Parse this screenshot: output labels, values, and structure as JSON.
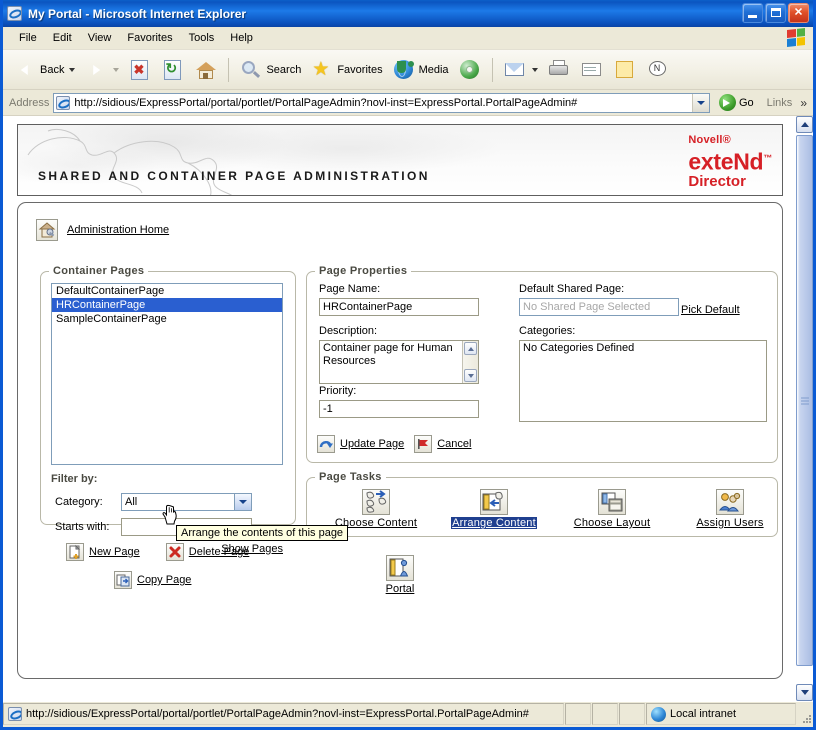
{
  "window": {
    "title": "My Portal - Microsoft Internet Explorer",
    "icon": "ie-document-icon",
    "minimize_label": "Minimize",
    "maximize_label": "Maximize",
    "close_label": "Close"
  },
  "menu": {
    "items": [
      {
        "label": "File"
      },
      {
        "label": "Edit"
      },
      {
        "label": "View"
      },
      {
        "label": "Favorites"
      },
      {
        "label": "Tools"
      },
      {
        "label": "Help"
      }
    ]
  },
  "toolbar": {
    "back_label": "Back",
    "forward_label": "",
    "stop_label": "",
    "refresh_label": "",
    "home_label": "",
    "search_label": "Search",
    "favorites_label": "Favorites",
    "media_label": "Media",
    "history_label": "",
    "mail_label": "",
    "print_label": "",
    "edit_label": "",
    "discuss_label": "",
    "messenger_label": ""
  },
  "address": {
    "label": "Address",
    "url": "http://sidious/ExpressPortal/portal/portlet/PortalPageAdmin?novl-inst=ExpressPortal.PortalPageAdmin#",
    "go_label": "Go",
    "links_label": "Links",
    "more_chevron": "»"
  },
  "banner": {
    "title": "SHARED AND CONTAINER PAGE ADMINISTRATION",
    "brand_line1": "Novell®",
    "brand_line2": "exteNd",
    "brand_tm": "™",
    "brand_line3": "Director"
  },
  "admin_home": {
    "label": "Administration Home",
    "icon": "admin-home-icon"
  },
  "container_pages": {
    "legend": "Container Pages",
    "items": [
      {
        "label": "DefaultContainerPage",
        "selected": false
      },
      {
        "label": "HRContainerPage",
        "selected": true
      },
      {
        "label": "SampleContainerPage",
        "selected": false
      }
    ],
    "filter_title": "Filter by:",
    "category_label": "Category:",
    "category_value": "All",
    "starts_with_label": "Starts with:",
    "starts_with_value": "",
    "show_pages_label": "Show Pages"
  },
  "page_properties": {
    "legend": "Page Properties",
    "page_name_label": "Page Name:",
    "page_name_value": "HRContainerPage",
    "description_label": "Description:",
    "description_value": "Container page for Human Resources",
    "priority_label": "Priority:",
    "priority_value": "-1",
    "default_shared_label": "Default Shared Page:",
    "default_shared_placeholder": "No Shared Page Selected",
    "pick_default_label": "Pick Default",
    "categories_label": "Categories:",
    "categories_value": "No Categories Defined",
    "update_label": "Update Page",
    "cancel_label": "Cancel"
  },
  "page_tasks": {
    "legend": "Page Tasks",
    "items": [
      {
        "label": "Choose Content",
        "icon": "choose-content-icon",
        "selected": false
      },
      {
        "label": "Arrange Content",
        "icon": "arrange-content-icon",
        "selected": true
      },
      {
        "label": "Choose Layout",
        "icon": "choose-layout-icon",
        "selected": false
      },
      {
        "label": "Assign Users",
        "icon": "assign-users-icon",
        "selected": false
      }
    ],
    "portal_label": "Portal",
    "portal_icon": "portal-icon",
    "tooltip": "Arrange the contents of this page"
  },
  "page_actions": {
    "new_page_label": "New Page",
    "delete_page_label": "Delete Page",
    "copy_page_label": "Copy Page"
  },
  "status_bar": {
    "url": "http://sidious/ExpressPortal/portal/portlet/PortalPageAdmin?novl-inst=ExpressPortal.PortalPageAdmin#",
    "zone": "Local intranet",
    "zone_icon": "globe-icon"
  },
  "colors": {
    "title_bar_blue": "#0b55c0",
    "selection_blue": "#2a5fd0",
    "task_selection_blue": "#1f3f8f",
    "brand_red": "#d62026",
    "chrome_beige": "#ece9d8",
    "tooltip_bg": "#ffffe1"
  }
}
